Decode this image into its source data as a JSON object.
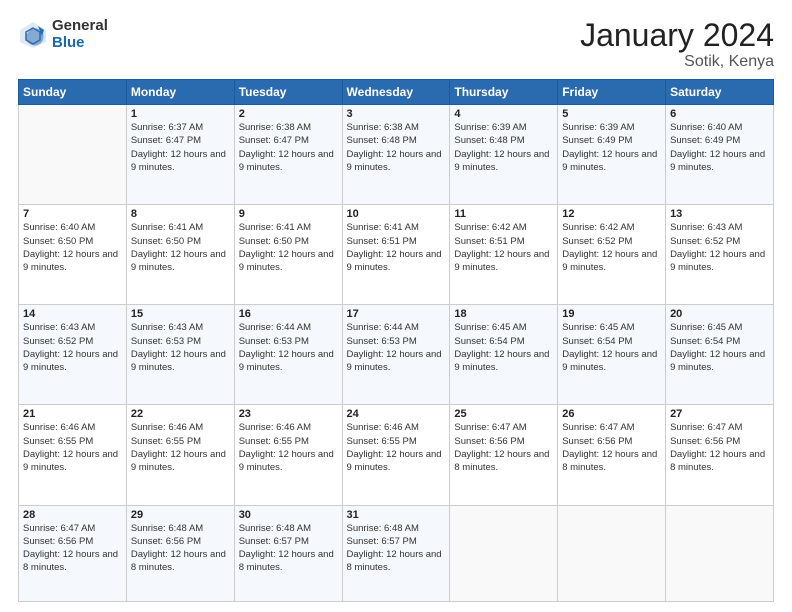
{
  "header": {
    "logo_general": "General",
    "logo_blue": "Blue",
    "month_title": "January 2024",
    "location": "Sotik, Kenya"
  },
  "days_of_week": [
    "Sunday",
    "Monday",
    "Tuesday",
    "Wednesday",
    "Thursday",
    "Friday",
    "Saturday"
  ],
  "weeks": [
    [
      {
        "day": "",
        "sunrise": "",
        "sunset": "",
        "daylight": ""
      },
      {
        "day": "1",
        "sunrise": "Sunrise: 6:37 AM",
        "sunset": "Sunset: 6:47 PM",
        "daylight": "Daylight: 12 hours and 9 minutes."
      },
      {
        "day": "2",
        "sunrise": "Sunrise: 6:38 AM",
        "sunset": "Sunset: 6:47 PM",
        "daylight": "Daylight: 12 hours and 9 minutes."
      },
      {
        "day": "3",
        "sunrise": "Sunrise: 6:38 AM",
        "sunset": "Sunset: 6:48 PM",
        "daylight": "Daylight: 12 hours and 9 minutes."
      },
      {
        "day": "4",
        "sunrise": "Sunrise: 6:39 AM",
        "sunset": "Sunset: 6:48 PM",
        "daylight": "Daylight: 12 hours and 9 minutes."
      },
      {
        "day": "5",
        "sunrise": "Sunrise: 6:39 AM",
        "sunset": "Sunset: 6:49 PM",
        "daylight": "Daylight: 12 hours and 9 minutes."
      },
      {
        "day": "6",
        "sunrise": "Sunrise: 6:40 AM",
        "sunset": "Sunset: 6:49 PM",
        "daylight": "Daylight: 12 hours and 9 minutes."
      }
    ],
    [
      {
        "day": "7",
        "sunrise": "Sunrise: 6:40 AM",
        "sunset": "Sunset: 6:50 PM",
        "daylight": "Daylight: 12 hours and 9 minutes."
      },
      {
        "day": "8",
        "sunrise": "Sunrise: 6:41 AM",
        "sunset": "Sunset: 6:50 PM",
        "daylight": "Daylight: 12 hours and 9 minutes."
      },
      {
        "day": "9",
        "sunrise": "Sunrise: 6:41 AM",
        "sunset": "Sunset: 6:50 PM",
        "daylight": "Daylight: 12 hours and 9 minutes."
      },
      {
        "day": "10",
        "sunrise": "Sunrise: 6:41 AM",
        "sunset": "Sunset: 6:51 PM",
        "daylight": "Daylight: 12 hours and 9 minutes."
      },
      {
        "day": "11",
        "sunrise": "Sunrise: 6:42 AM",
        "sunset": "Sunset: 6:51 PM",
        "daylight": "Daylight: 12 hours and 9 minutes."
      },
      {
        "day": "12",
        "sunrise": "Sunrise: 6:42 AM",
        "sunset": "Sunset: 6:52 PM",
        "daylight": "Daylight: 12 hours and 9 minutes."
      },
      {
        "day": "13",
        "sunrise": "Sunrise: 6:43 AM",
        "sunset": "Sunset: 6:52 PM",
        "daylight": "Daylight: 12 hours and 9 minutes."
      }
    ],
    [
      {
        "day": "14",
        "sunrise": "Sunrise: 6:43 AM",
        "sunset": "Sunset: 6:52 PM",
        "daylight": "Daylight: 12 hours and 9 minutes."
      },
      {
        "day": "15",
        "sunrise": "Sunrise: 6:43 AM",
        "sunset": "Sunset: 6:53 PM",
        "daylight": "Daylight: 12 hours and 9 minutes."
      },
      {
        "day": "16",
        "sunrise": "Sunrise: 6:44 AM",
        "sunset": "Sunset: 6:53 PM",
        "daylight": "Daylight: 12 hours and 9 minutes."
      },
      {
        "day": "17",
        "sunrise": "Sunrise: 6:44 AM",
        "sunset": "Sunset: 6:53 PM",
        "daylight": "Daylight: 12 hours and 9 minutes."
      },
      {
        "day": "18",
        "sunrise": "Sunrise: 6:45 AM",
        "sunset": "Sunset: 6:54 PM",
        "daylight": "Daylight: 12 hours and 9 minutes."
      },
      {
        "day": "19",
        "sunrise": "Sunrise: 6:45 AM",
        "sunset": "Sunset: 6:54 PM",
        "daylight": "Daylight: 12 hours and 9 minutes."
      },
      {
        "day": "20",
        "sunrise": "Sunrise: 6:45 AM",
        "sunset": "Sunset: 6:54 PM",
        "daylight": "Daylight: 12 hours and 9 minutes."
      }
    ],
    [
      {
        "day": "21",
        "sunrise": "Sunrise: 6:46 AM",
        "sunset": "Sunset: 6:55 PM",
        "daylight": "Daylight: 12 hours and 9 minutes."
      },
      {
        "day": "22",
        "sunrise": "Sunrise: 6:46 AM",
        "sunset": "Sunset: 6:55 PM",
        "daylight": "Daylight: 12 hours and 9 minutes."
      },
      {
        "day": "23",
        "sunrise": "Sunrise: 6:46 AM",
        "sunset": "Sunset: 6:55 PM",
        "daylight": "Daylight: 12 hours and 9 minutes."
      },
      {
        "day": "24",
        "sunrise": "Sunrise: 6:46 AM",
        "sunset": "Sunset: 6:55 PM",
        "daylight": "Daylight: 12 hours and 9 minutes."
      },
      {
        "day": "25",
        "sunrise": "Sunrise: 6:47 AM",
        "sunset": "Sunset: 6:56 PM",
        "daylight": "Daylight: 12 hours and 8 minutes."
      },
      {
        "day": "26",
        "sunrise": "Sunrise: 6:47 AM",
        "sunset": "Sunset: 6:56 PM",
        "daylight": "Daylight: 12 hours and 8 minutes."
      },
      {
        "day": "27",
        "sunrise": "Sunrise: 6:47 AM",
        "sunset": "Sunset: 6:56 PM",
        "daylight": "Daylight: 12 hours and 8 minutes."
      }
    ],
    [
      {
        "day": "28",
        "sunrise": "Sunrise: 6:47 AM",
        "sunset": "Sunset: 6:56 PM",
        "daylight": "Daylight: 12 hours and 8 minutes."
      },
      {
        "day": "29",
        "sunrise": "Sunrise: 6:48 AM",
        "sunset": "Sunset: 6:56 PM",
        "daylight": "Daylight: 12 hours and 8 minutes."
      },
      {
        "day": "30",
        "sunrise": "Sunrise: 6:48 AM",
        "sunset": "Sunset: 6:57 PM",
        "daylight": "Daylight: 12 hours and 8 minutes."
      },
      {
        "day": "31",
        "sunrise": "Sunrise: 6:48 AM",
        "sunset": "Sunset: 6:57 PM",
        "daylight": "Daylight: 12 hours and 8 minutes."
      },
      {
        "day": "",
        "sunrise": "",
        "sunset": "",
        "daylight": ""
      },
      {
        "day": "",
        "sunrise": "",
        "sunset": "",
        "daylight": ""
      },
      {
        "day": "",
        "sunrise": "",
        "sunset": "",
        "daylight": ""
      }
    ]
  ]
}
